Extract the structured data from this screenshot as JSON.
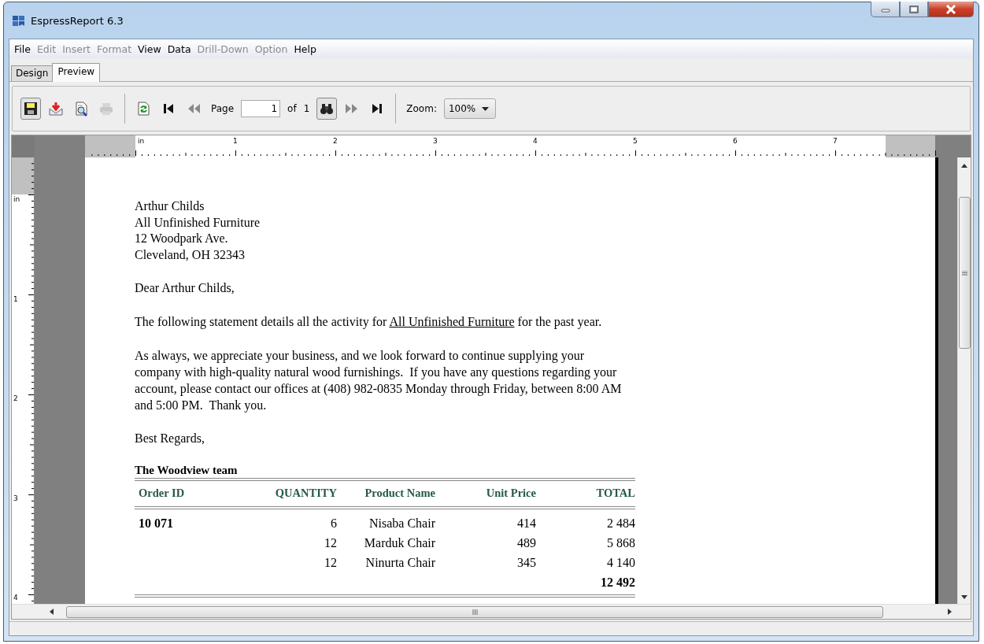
{
  "window": {
    "title": "EspressReport 6.3"
  },
  "menu": [
    {
      "label": "File",
      "disabled": false
    },
    {
      "label": "Edit",
      "disabled": true
    },
    {
      "label": "Insert",
      "disabled": true
    },
    {
      "label": "Format",
      "disabled": true
    },
    {
      "label": "View",
      "disabled": false
    },
    {
      "label": "Data",
      "disabled": false
    },
    {
      "label": "Drill-Down",
      "disabled": true
    },
    {
      "label": "Option",
      "disabled": true
    },
    {
      "label": "Help",
      "disabled": false
    }
  ],
  "tabs": [
    {
      "label": "Design",
      "selected": false
    },
    {
      "label": "Preview",
      "selected": true
    }
  ],
  "toolbar": {
    "items": [
      {
        "kind": "save",
        "disabled": false,
        "pressed": true
      },
      {
        "kind": "export",
        "disabled": false,
        "pressed": false
      },
      {
        "kind": "preview",
        "disabled": false,
        "pressed": false
      },
      {
        "kind": "print",
        "disabled": true,
        "pressed": false
      },
      {
        "kind": "separator"
      },
      {
        "kind": "refresh",
        "disabled": false,
        "pressed": false
      },
      {
        "kind": "first",
        "disabled": false,
        "pressed": false
      },
      {
        "kind": "prev",
        "disabled": true,
        "pressed": false
      },
      {
        "kind": "page",
        "label": "Page",
        "value": "1",
        "of_label": "of",
        "total": "1"
      },
      {
        "kind": "find",
        "disabled": false,
        "pressed": true
      },
      {
        "kind": "next",
        "disabled": true,
        "pressed": false
      },
      {
        "kind": "last",
        "disabled": false,
        "pressed": false
      },
      {
        "kind": "separator"
      },
      {
        "kind": "zoom",
        "label": "Zoom:",
        "value": "100%"
      }
    ]
  },
  "top_ruler": {
    "labels": [
      "in",
      "1",
      "2",
      "3",
      "4",
      "5",
      "6",
      "7"
    ]
  },
  "left_ruler": {
    "labels": [
      "in",
      "1",
      "2",
      "3",
      "4"
    ]
  },
  "report": {
    "address": [
      "Arthur Childs",
      "All Unfinished Furniture",
      "12 Woodpark  Ave.",
      "Cleveland, OH 32343"
    ],
    "greeting": "Dear Arthur Childs,",
    "statement": {
      "before": "The following statement details all the activity for",
      "highlight": "All Unfinished Furniture",
      "after": "for the past year."
    },
    "body": "As always, we appreciate your business, and we look forward to continue supplying your company with high-quality natural wood furnishings.  If you have any questions regarding your account, please contact our offices at (408) 982-0835 Monday through Friday, between 8:00 AM and 5:00 PM.  Thank you.",
    "closing": "Best Regards,",
    "signature": "The Woodview team",
    "table": {
      "columns": [
        "Order ID",
        "QUANTITY",
        "Product Name",
        "Unit Price",
        "TOTAL"
      ],
      "rows": [
        [
          "10 071",
          "6",
          "Nisaba Chair",
          "414",
          "2 484"
        ],
        [
          "",
          "12",
          "Marduk Chair",
          "489",
          "5 868"
        ],
        [
          "",
          "12",
          "Ninurta Chair",
          "345",
          "4 140"
        ]
      ],
      "total": "12 492"
    }
  }
}
